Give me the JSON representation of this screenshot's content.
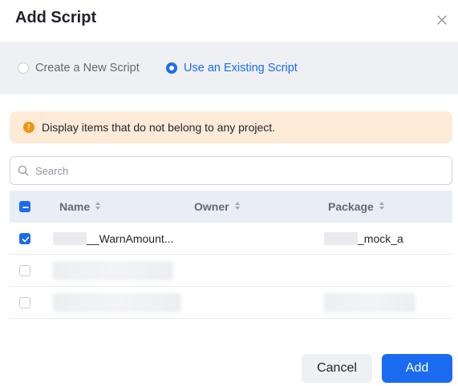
{
  "dialog": {
    "title": "Add Script",
    "close_icon": "close-icon"
  },
  "mode": {
    "options": [
      {
        "label": "Create a New Script",
        "selected": false
      },
      {
        "label": "Use an Existing Script",
        "selected": true
      }
    ]
  },
  "alert": {
    "icon": "info-icon",
    "text": "Display items that do not belong to any project."
  },
  "search": {
    "placeholder": "Search",
    "value": ""
  },
  "table": {
    "select_all_state": "indeterminate",
    "columns": [
      {
        "label": "Name",
        "sortable": true
      },
      {
        "label": "Owner",
        "sortable": true
      },
      {
        "label": "Package",
        "sortable": true
      }
    ],
    "rows": [
      {
        "checked": true,
        "name": "__WarnAmount...",
        "owner": "",
        "package": "_mock_a"
      },
      {
        "checked": false,
        "name": "",
        "owner": "",
        "package": ""
      },
      {
        "checked": false,
        "name": "",
        "owner": "",
        "package": ""
      }
    ]
  },
  "footer": {
    "cancel_label": "Cancel",
    "add_label": "Add"
  },
  "colors": {
    "accent": "#1a6bf0",
    "alert_bg": "#fdebd8",
    "alert_icon": "#f0930f"
  }
}
